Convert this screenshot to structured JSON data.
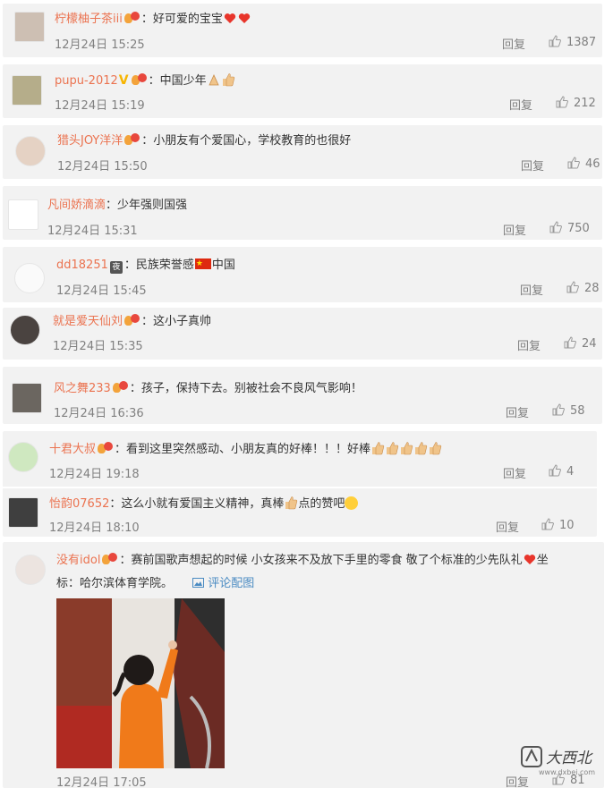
{
  "comments": [
    {
      "username": "柠檬柚子茶iii",
      "text": "：好可爱的宝宝",
      "time": "12月24日 15:25",
      "reply": "回复",
      "likes": "1387"
    },
    {
      "username": "pupu-2012",
      "text": "：中国少年",
      "time": "12月24日 15:19",
      "reply": "回复",
      "likes": "212"
    },
    {
      "username": "猎头JOY洋洋",
      "text": "：小朋友有个爱国心，学校教育的也很好",
      "time": "12月24日 15:50",
      "reply": "回复",
      "likes": "46"
    },
    {
      "username": "凡间娇滴滴",
      "text": "：少年强则国强",
      "time": "12月24日 15:31",
      "reply": "回复",
      "likes": "750"
    },
    {
      "username": "dd18251",
      "text_before_flag": "：民族荣誉感",
      "text_after_flag": "中国",
      "time": "12月24日 15:45",
      "reply": "回复",
      "likes": "28"
    },
    {
      "username": "就是爱天仙刘",
      "text": "：这小子真帅",
      "time": "12月24日 15:35",
      "reply": "回复",
      "likes": "24"
    },
    {
      "username": "风之舞233",
      "text": "：孩子，保持下去。别被社会不良风气影响！",
      "time": "12月24日 16:36",
      "reply": "回复",
      "likes": "58"
    },
    {
      "username": "十君大叔",
      "text": "：看到这里突然感动、小朋友真的好棒！！！好棒",
      "time": "12月24日 19:18",
      "reply": "回复",
      "likes": "4"
    },
    {
      "username": "怡韵07652",
      "text_before_thumb": "：这么小就有爱国主义精神，真棒",
      "text_after_thumb": "点的赞吧",
      "time": "12月24日 18:10",
      "reply": "回复",
      "likes": "10"
    },
    {
      "username": "没有idol",
      "text_line1": "：赛前国歌声想起的时候 小女孩来不及放下手里的零食 敬了个标准的少先队礼",
      "text_line1_end": "坐",
      "text_line2": "标：哈尔滨体育学院。",
      "image_link": "评论配图",
      "time": "12月24日 17:05",
      "reply": "回复",
      "likes": "81"
    }
  ],
  "vip_tag": "夜",
  "watermark": {
    "name": "大西北",
    "url": "www.dxbei.com"
  },
  "colors": {
    "username": "#eb7350",
    "meta": "#808080",
    "card_bg": "#f2f2f2",
    "link": "#4a8bc2"
  }
}
